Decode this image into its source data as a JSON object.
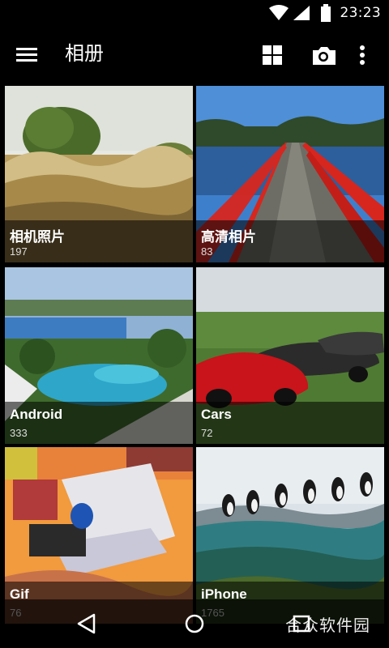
{
  "status_bar": {
    "time": "23:23"
  },
  "app_bar": {
    "title": "相册"
  },
  "albums": [
    {
      "name": "相机照片",
      "count": "197"
    },
    {
      "name": "高清相片",
      "count": "83"
    },
    {
      "name": "Android",
      "count": "333"
    },
    {
      "name": "Cars",
      "count": "72"
    },
    {
      "name": "Gif",
      "count": "76"
    },
    {
      "name": "iPhone",
      "count": "1765"
    }
  ],
  "watermark": {
    "text": "合众软件园",
    "url": "www.hezhong.net"
  },
  "icons": {
    "menu": "hamburger-icon",
    "grid": "grid-view-icon",
    "camera": "camera-icon",
    "overflow": "more-vert-icon",
    "back": "back-triangle-icon",
    "home": "home-circle-icon",
    "recents": "recents-square-icon"
  },
  "colors": {
    "background": "#000000",
    "bridge_red": "#d7261e",
    "car_red": "#c8141a"
  }
}
